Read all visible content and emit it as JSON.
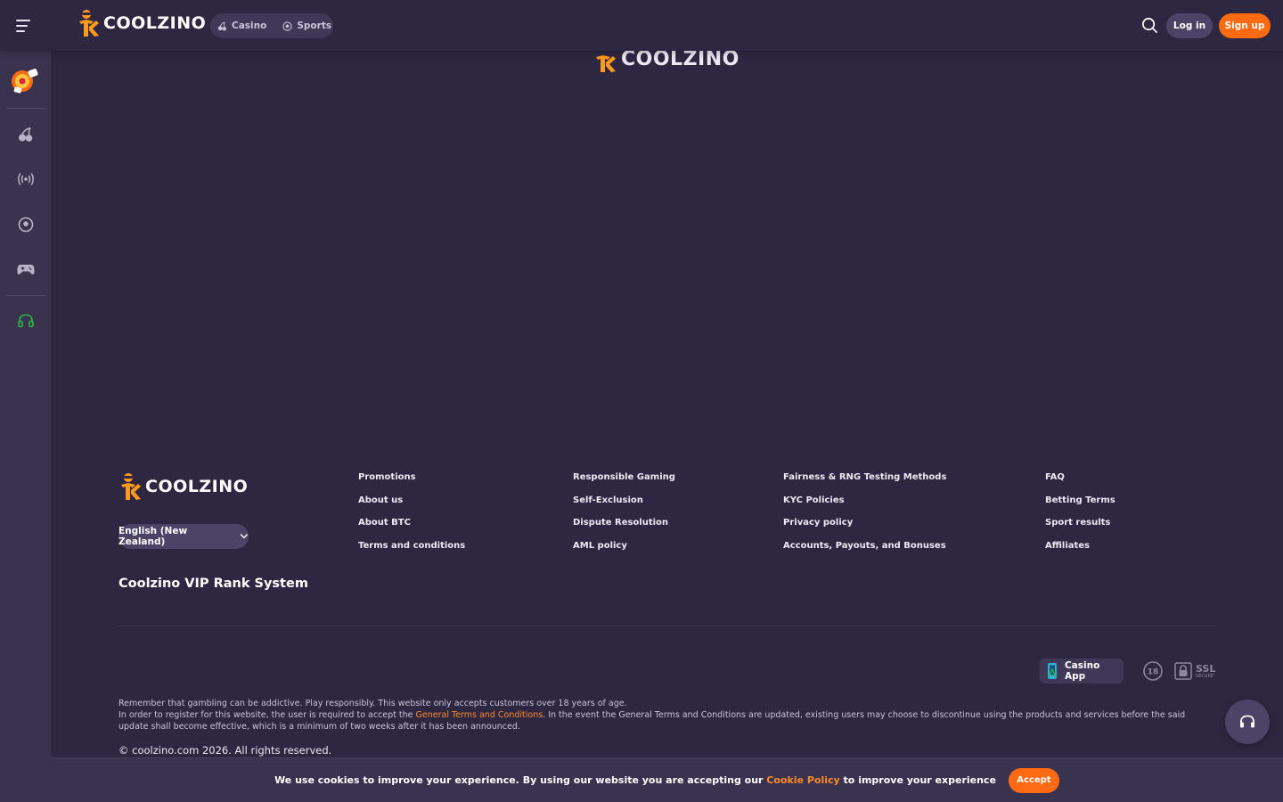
{
  "header": {
    "logo_text": "COOLZINO",
    "tabs": [
      {
        "label": "Casino",
        "icon": "cherry-icon"
      },
      {
        "label": "Sports",
        "icon": "soccer-ball-icon"
      }
    ],
    "login_label": "Log in",
    "signup_label": "Sign up"
  },
  "sidebar": {
    "items": [
      {
        "icon": "promo-wheel-icon"
      },
      {
        "icon": "cherry-icon"
      },
      {
        "icon": "live-broadcast-icon"
      },
      {
        "icon": "soccer-ball-icon"
      },
      {
        "icon": "gamepad-icon"
      },
      {
        "icon": "headset-icon"
      }
    ]
  },
  "main": {
    "top_logo_text": "COOLZINO"
  },
  "footer": {
    "logo_text": "COOLZINO",
    "language": "English (New Zealand)",
    "vip_title": "Coolzino VIP Rank System",
    "columns": [
      [
        "Promotions",
        "About us",
        "About BTC",
        "Terms and conditions"
      ],
      [
        "Responsible Gaming",
        "Self-Exclusion",
        "Dispute Resolution",
        "AML policy"
      ],
      [
        "Fairness & RNG Testing Methods",
        "KYC Policies",
        "Privacy policy",
        "Accounts, Payouts, and Bonuses"
      ],
      [
        "FAQ",
        "Betting Terms",
        "Sport results",
        "Affiliates"
      ]
    ],
    "casino_app_label": "Casino App",
    "age_badge": "18",
    "ssl_label": "SSL",
    "ssl_sub": "SECURE",
    "disclaimer_line1": "Remember that gambling can be addictive. Play responsibly. This website only accepts customers over 18 years of age.",
    "disclaimer_line2_prefix": "In order to register for this website, the user is required to accept the ",
    "disclaimer_link": "General Terms and Conditions",
    "disclaimer_line2_suffix": ". In the event the General Terms and Conditions are updated, existing users may choose to discontinue using the products and services before the said update shall become effective, which is a minimum of two weeks after it has been announced.",
    "copyright": "© coolzino.com 2026. All rights reserved."
  },
  "cookie": {
    "text_prefix": "We use cookies to improve your experience. By using our website you are accepting our ",
    "link": "Cookie Policy",
    "text_suffix": " to improve your experience",
    "accept_label": "Accept"
  },
  "colors": {
    "background": "#2e2741",
    "sidebar": "#3a3350",
    "accent": "#ff6a13",
    "link": "#ff8a2b",
    "headset_green": "#2fb344"
  }
}
